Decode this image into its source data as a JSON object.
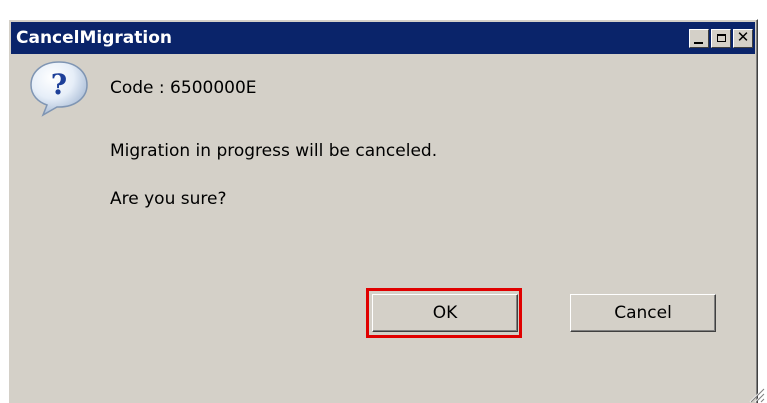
{
  "window": {
    "title": "CancelMigration",
    "controls": {
      "minimize": "minimize-icon",
      "maximize": "maximize-icon",
      "close": "close-icon"
    }
  },
  "dialog": {
    "icon": "question-icon",
    "code": "Code : 6500000E",
    "message": "Migration in progress will be canceled.",
    "question": "Are you sure?"
  },
  "buttons": {
    "ok_label": "OK",
    "cancel_label": "Cancel"
  },
  "colors": {
    "titlebar": "#0a246a",
    "window_bg": "#d4d0c8",
    "highlight": "#e00000"
  }
}
